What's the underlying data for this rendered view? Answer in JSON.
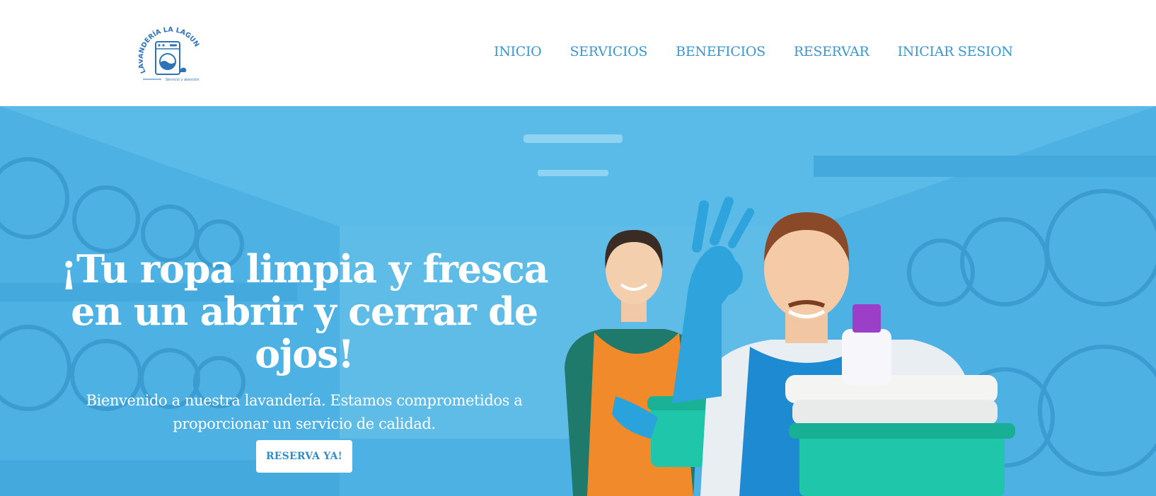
{
  "brand": {
    "name": "LAVANDERÍA LA LAGUNA AZUL",
    "tagline": "Servicio y atención",
    "color": "#2e73b8"
  },
  "nav": {
    "items": [
      {
        "label": "INICIO"
      },
      {
        "label": "SERVICIOS"
      },
      {
        "label": "BENEFICIOS"
      },
      {
        "label": "RESERVAR"
      },
      {
        "label": "INICIAR SESION"
      }
    ],
    "color": "#3b97cf"
  },
  "hero": {
    "title": "¡Tu ropa limpia y fresca en un abrir y cerrar de ojos!",
    "subtitle": "Bienvenido a nuestra lavandería. Estamos comprometidos a proporcionar un servicio de calidad.",
    "cta_label": "RESERVA YA!",
    "background_color": "#4db1e3",
    "image_description_icon": "laundromat-workers-image"
  }
}
